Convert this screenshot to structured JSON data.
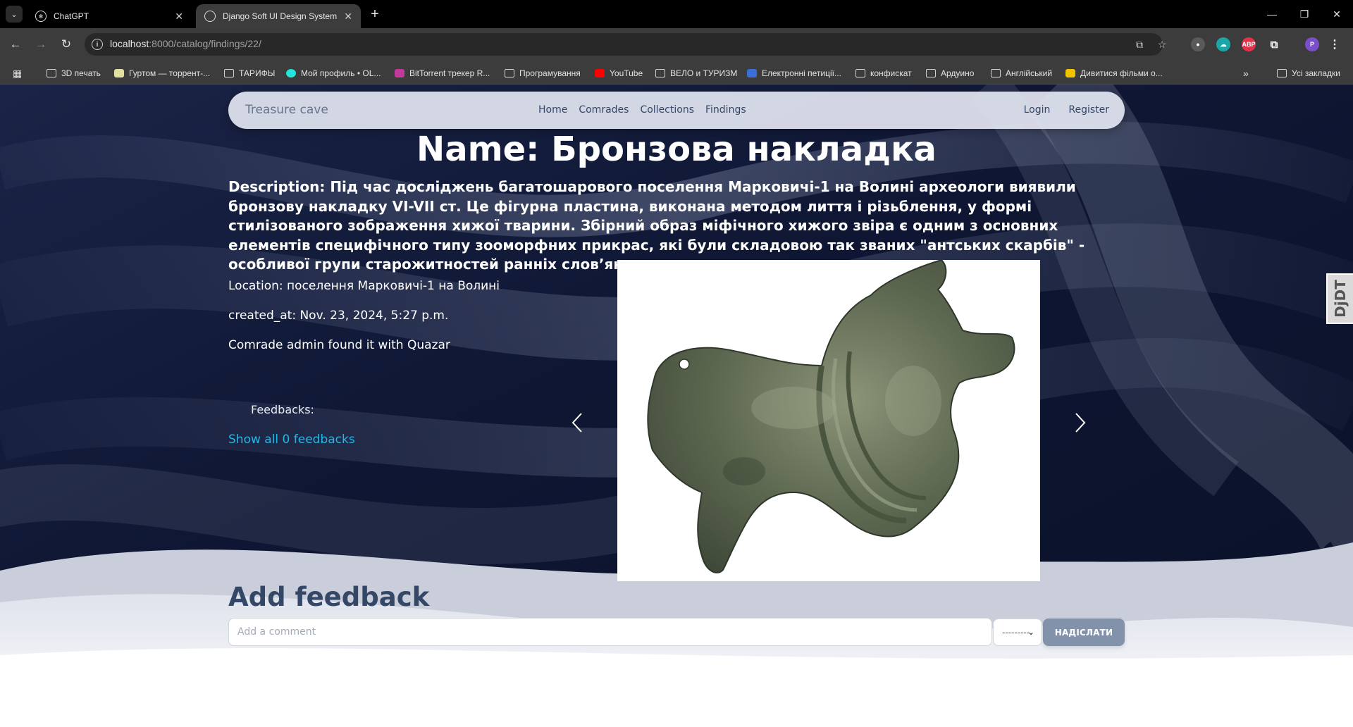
{
  "browser": {
    "tabs": [
      {
        "title": "ChatGPT",
        "favicon": "chatgpt-logo-icon"
      },
      {
        "title": "Django Soft UI Design System",
        "favicon": "globe-icon"
      }
    ],
    "url_host": "localhost",
    "url_rest": ":8000/catalog/findings/22/",
    "bookmarks": [
      {
        "label": "3D печать",
        "icon": "folder-icon"
      },
      {
        "label": "Гуртом — торрент-...",
        "icon": "site-icon"
      },
      {
        "label": "ТАРИФЫ",
        "icon": "folder-icon"
      },
      {
        "label": "Мой профиль • OL...",
        "icon": "site-icon"
      },
      {
        "label": "BitTorrent трекер R...",
        "icon": "site-icon"
      },
      {
        "label": "Програмування",
        "icon": "folder-icon"
      },
      {
        "label": "YouTube",
        "icon": "youtube-icon"
      },
      {
        "label": "ВЕЛО и ТУРИЗМ",
        "icon": "folder-icon"
      },
      {
        "label": "Електронні петиції...",
        "icon": "site-icon"
      },
      {
        "label": "конфискат",
        "icon": "folder-icon"
      },
      {
        "label": "Ардуино",
        "icon": "folder-icon"
      },
      {
        "label": "Англійський",
        "icon": "folder-icon"
      },
      {
        "label": "Дивитися фільми о...",
        "icon": "site-icon"
      }
    ],
    "all_bookmarks": "Усі закладки"
  },
  "navbar": {
    "brand": "Treasure cave",
    "links": [
      "Home",
      "Comrades",
      "Collections",
      "Findings"
    ],
    "login": "Login",
    "register": "Register"
  },
  "finding": {
    "title": "Name: Бронзова накладка",
    "description": "Description: Під час досліджень багатошарового поселення Марковичі-1 на Волині археологи виявили бронзову накладку VI-VII ст. Це фігурна пластина, виконана методом лиття і різьблення, у формі стилізованого зображення хижої тварини. Збірний образ міфічного хижого звіра є одним з основних елементів специфічного типу зооморфних прикрас, які були складовою так званих \"антських скарбів\" - особливої групи старожитностей ранніх слов’ян.",
    "location": "Location: поселення Марковичі-1 на Волині",
    "created_at": "created_at: Nov. 23, 2024, 5:27 p.m.",
    "found_by": "Comrade admin found it with Quazar",
    "feedbacks_label": "Feedbacks:",
    "show_all": "Show all 0 feedbacks"
  },
  "debug_toolbar": "DjDT",
  "feedback_form": {
    "heading": "Add feedback",
    "comment_placeholder": "Add a comment",
    "rating_selected": "---------",
    "submit": "НАДІСЛАТИ"
  },
  "colors": {
    "hero_dark": "#0d1530",
    "brand_text": "#67748e",
    "nav_text": "#344767",
    "link": "#21b8e7",
    "submit_bg": "#8392ab"
  }
}
